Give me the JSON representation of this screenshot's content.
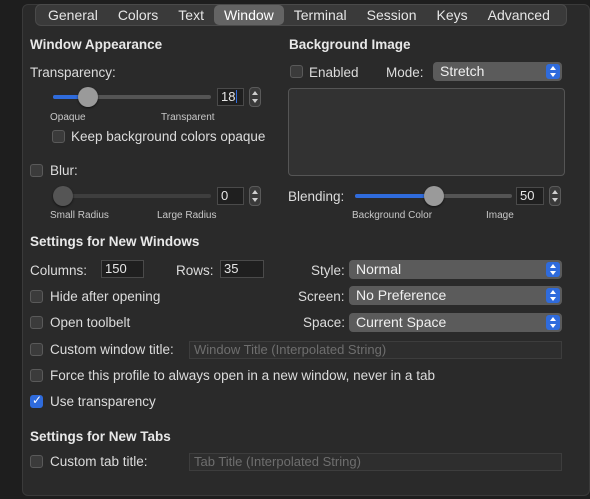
{
  "tabs": [
    "General",
    "Colors",
    "Text",
    "Window",
    "Terminal",
    "Session",
    "Keys",
    "Advanced"
  ],
  "active_tab": "Window",
  "window_appearance": {
    "heading": "Window Appearance",
    "transparency_label": "Transparency:",
    "transparency_value": "18",
    "transparency_level": 0.18,
    "opaque_label": "Opaque",
    "transparent_label": "Transparent",
    "keep_bg_opaque_label": "Keep background colors opaque",
    "keep_bg_opaque_checked": false,
    "blur_label": "Blur:",
    "blur_checked": false,
    "blur_value": "0",
    "small_radius_label": "Small Radius",
    "large_radius_label": "Large Radius"
  },
  "background_image": {
    "heading": "Background Image",
    "enabled_label": "Enabled",
    "enabled_checked": false,
    "mode_label": "Mode:",
    "mode_value": "Stretch",
    "blending_label": "Blending:",
    "blending_value": "50",
    "blending_level": 0.5,
    "background_color_label": "Background Color",
    "image_label": "Image"
  },
  "new_windows": {
    "heading": "Settings for New Windows",
    "columns_label": "Columns:",
    "columns_value": "150",
    "rows_label": "Rows:",
    "rows_value": "35",
    "style_label": "Style:",
    "style_value": "Normal",
    "screen_label": "Screen:",
    "screen_value": "No Preference",
    "space_label": "Space:",
    "space_value": "Current Space",
    "hide_after_opening_label": "Hide after opening",
    "open_toolbelt_label": "Open toolbelt",
    "custom_window_title_label": "Custom window title:",
    "window_title_placeholder": "Window Title (Interpolated String)",
    "force_new_window_label": "Force this profile to always open in a new window, never in a tab",
    "use_transparency_label": "Use transparency",
    "use_transparency_checked": true
  },
  "new_tabs": {
    "heading": "Settings for New Tabs",
    "custom_tab_title_label": "Custom tab title:",
    "tab_title_placeholder": "Tab Title (Interpolated String)"
  },
  "colors": {
    "accent": "#2f6bdc",
    "panel": "#2a2a2a",
    "text": "#dcdcdc"
  }
}
